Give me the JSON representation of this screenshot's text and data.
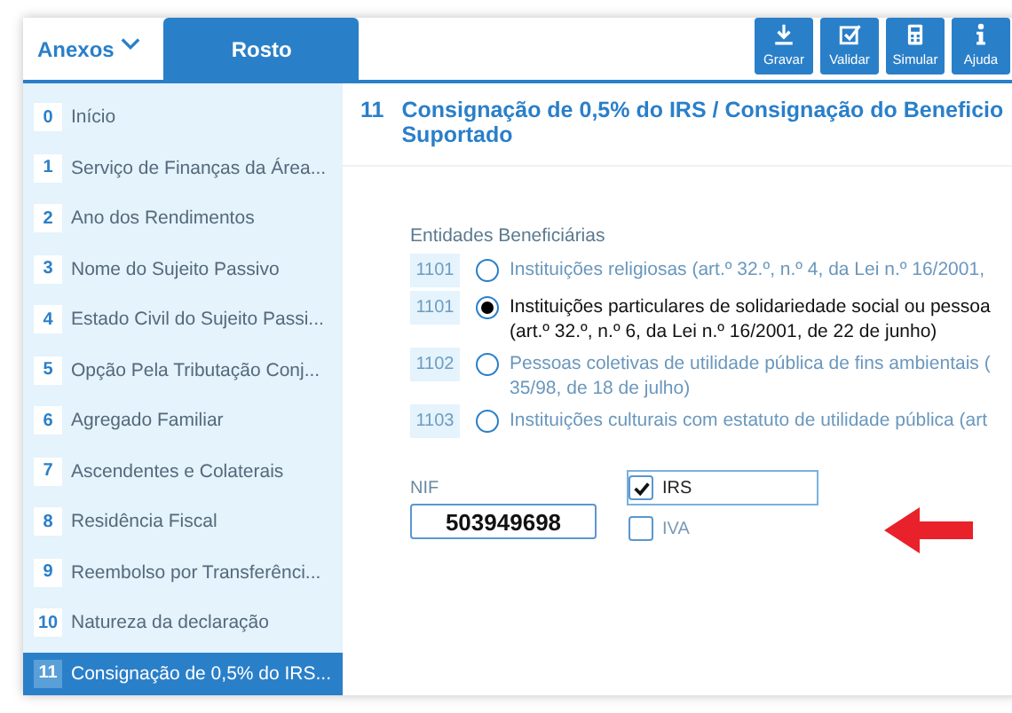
{
  "header": {
    "annexes_menu": "Anexos",
    "tabs": [
      {
        "label": "Rosto",
        "selected": true
      }
    ],
    "toolbar": [
      {
        "label": "Gravar",
        "kind": "save"
      },
      {
        "label": "Validar",
        "kind": "validate"
      },
      {
        "label": "Simular",
        "kind": "simulate"
      },
      {
        "label": "Ajuda",
        "kind": "help"
      }
    ]
  },
  "sidebar": {
    "items": [
      {
        "number": "0",
        "label": "Início",
        "selected": false
      },
      {
        "number": "1",
        "label": "Serviço de Finanças da Área...",
        "selected": false
      },
      {
        "number": "2",
        "label": "Ano dos Rendimentos",
        "selected": false
      },
      {
        "number": "3",
        "label": "Nome do Sujeito Passivo",
        "selected": false
      },
      {
        "number": "4",
        "label": "Estado Civil do Sujeito Passi...",
        "selected": false
      },
      {
        "number": "5",
        "label": "Opção Pela Tributação Conj...",
        "selected": false
      },
      {
        "number": "6",
        "label": "Agregado Familiar",
        "selected": false
      },
      {
        "number": "7",
        "label": "Ascendentes e Colaterais",
        "selected": false
      },
      {
        "number": "8",
        "label": "Residência Fiscal",
        "selected": false
      },
      {
        "number": "9",
        "label": "Reembolso por Transferênci...",
        "selected": false
      },
      {
        "number": "10",
        "label": "Natureza da declaração",
        "selected": false
      },
      {
        "number": "11",
        "label": "Consignação de 0,5% do IRS...",
        "selected": true
      }
    ]
  },
  "section": {
    "number": "11",
    "title": "Consignação de 0,5% do IRS / Consignação do Beneficio",
    "title_line_2": "Suportado",
    "entities_label": "Entidades Beneficiárias",
    "entities": [
      {
        "code": "1101",
        "lines": [
          "Instituições religiosas (art.º 32.º, n.º 4, da Lei n.º 16/2001,"
        ],
        "selected": false
      },
      {
        "code": "1101",
        "lines": [
          "Instituições particulares de solidariedade social ou pessoa",
          "(art.º 32.º, n.º 6, da Lei n.º 16/2001, de 22 de junho)"
        ],
        "selected": true
      },
      {
        "code": "1102",
        "lines": [
          "Pessoas coletivas de utilidade pública de fins ambientais (",
          "35/98, de 18 de julho)"
        ],
        "selected": false
      },
      {
        "code": "1103",
        "lines": [
          "Instituições culturais com estatuto de utilidade pública (art"
        ],
        "selected": false
      }
    ],
    "nif": {
      "label": "NIF",
      "value": "503949698"
    },
    "taxes": [
      {
        "label": "IRS",
        "checked": true
      },
      {
        "label": "IVA",
        "checked": false
      }
    ]
  }
}
